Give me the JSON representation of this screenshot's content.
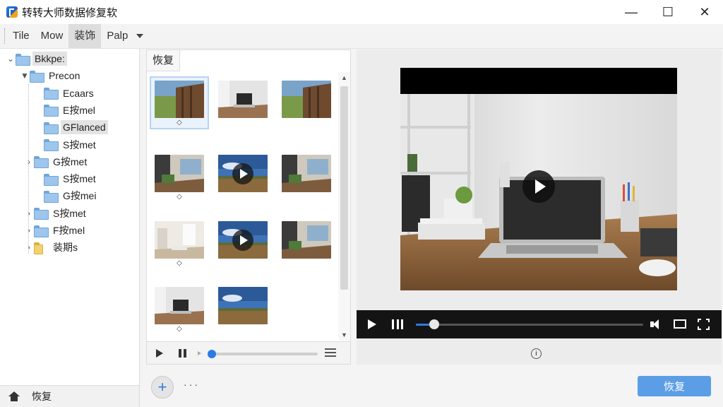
{
  "window": {
    "title": "转转大师数据修复软",
    "controls": {
      "minimize": "—",
      "maximize": "☐",
      "close": "✕"
    }
  },
  "menu": {
    "items": [
      {
        "label": "Tile",
        "active": false
      },
      {
        "label": "Mow",
        "active": false
      },
      {
        "label": "装饰",
        "active": true
      },
      {
        "label": "Palp",
        "active": false
      }
    ]
  },
  "tree": {
    "items": [
      {
        "label": "Bkkpe:",
        "chevron": "⌄",
        "icon": "folder-icon",
        "selected": true
      },
      {
        "label": "Precon",
        "chevron": "▼",
        "icon": "folder-icon",
        "selected": false
      },
      {
        "label": "Ecaars",
        "chevron": "",
        "icon": "folder-icon",
        "selected": false
      },
      {
        "label": "E按mel",
        "chevron": "",
        "icon": "folder-icon",
        "selected": false
      },
      {
        "label": "GFlanced",
        "chevron": "",
        "icon": "folder-icon",
        "selected": true
      },
      {
        "label": "S按met",
        "chevron": "",
        "icon": "folder-icon",
        "selected": false
      },
      {
        "label": "G按met",
        "chevron": "›",
        "icon": "folder-icon",
        "selected": false
      },
      {
        "label": "S按met",
        "chevron": "",
        "icon": "folder-icon",
        "selected": false
      },
      {
        "label": "G按mei",
        "chevron": "",
        "icon": "folder-icon",
        "selected": false
      },
      {
        "label": "S按met",
        "chevron": "›",
        "icon": "folder-icon",
        "selected": false
      },
      {
        "label": "F按mel",
        "chevron": "›",
        "icon": "folder-icon",
        "selected": false
      },
      {
        "label": "装期s",
        "chevron": "›",
        "icon": "yellow-folder-icon",
        "selected": false
      }
    ],
    "footer_label": "恢复"
  },
  "gallery": {
    "tab_label": "恢复",
    "thumbnails": [
      {
        "kind": "image",
        "marker": "◇",
        "selected": true,
        "scene": "landscape-wood"
      },
      {
        "kind": "image",
        "marker": "",
        "selected": false,
        "scene": "desk-laptop"
      },
      {
        "kind": "image",
        "marker": "",
        "selected": false,
        "scene": "landscape-wood"
      },
      {
        "kind": "image",
        "marker": "◇",
        "selected": false,
        "scene": "office-room"
      },
      {
        "kind": "video",
        "marker": "",
        "selected": false,
        "scene": "sky-field"
      },
      {
        "kind": "image",
        "marker": "",
        "selected": false,
        "scene": "office-room"
      },
      {
        "kind": "image",
        "marker": "◇",
        "selected": false,
        "scene": "bright-room"
      },
      {
        "kind": "video",
        "marker": "",
        "selected": false,
        "scene": "sky-field"
      },
      {
        "kind": "image",
        "marker": "",
        "selected": false,
        "scene": "office-room"
      },
      {
        "kind": "image",
        "marker": "◇",
        "selected": false,
        "scene": "desk-laptop"
      },
      {
        "kind": "image",
        "marker": "",
        "selected": false,
        "scene": "sky-field"
      }
    ],
    "scroll_up": "▲",
    "scroll_down": "▼",
    "progress_fraction": 0.0
  },
  "preview": {
    "progress_fraction": 0.08,
    "info_glyph": "i"
  },
  "actions": {
    "add_label": "+",
    "more_label": "···",
    "recover_label": "恢复"
  },
  "colors": {
    "accent": "#2a7be4",
    "recover_button": "#5b9ee6",
    "player_bar": "#141414"
  }
}
